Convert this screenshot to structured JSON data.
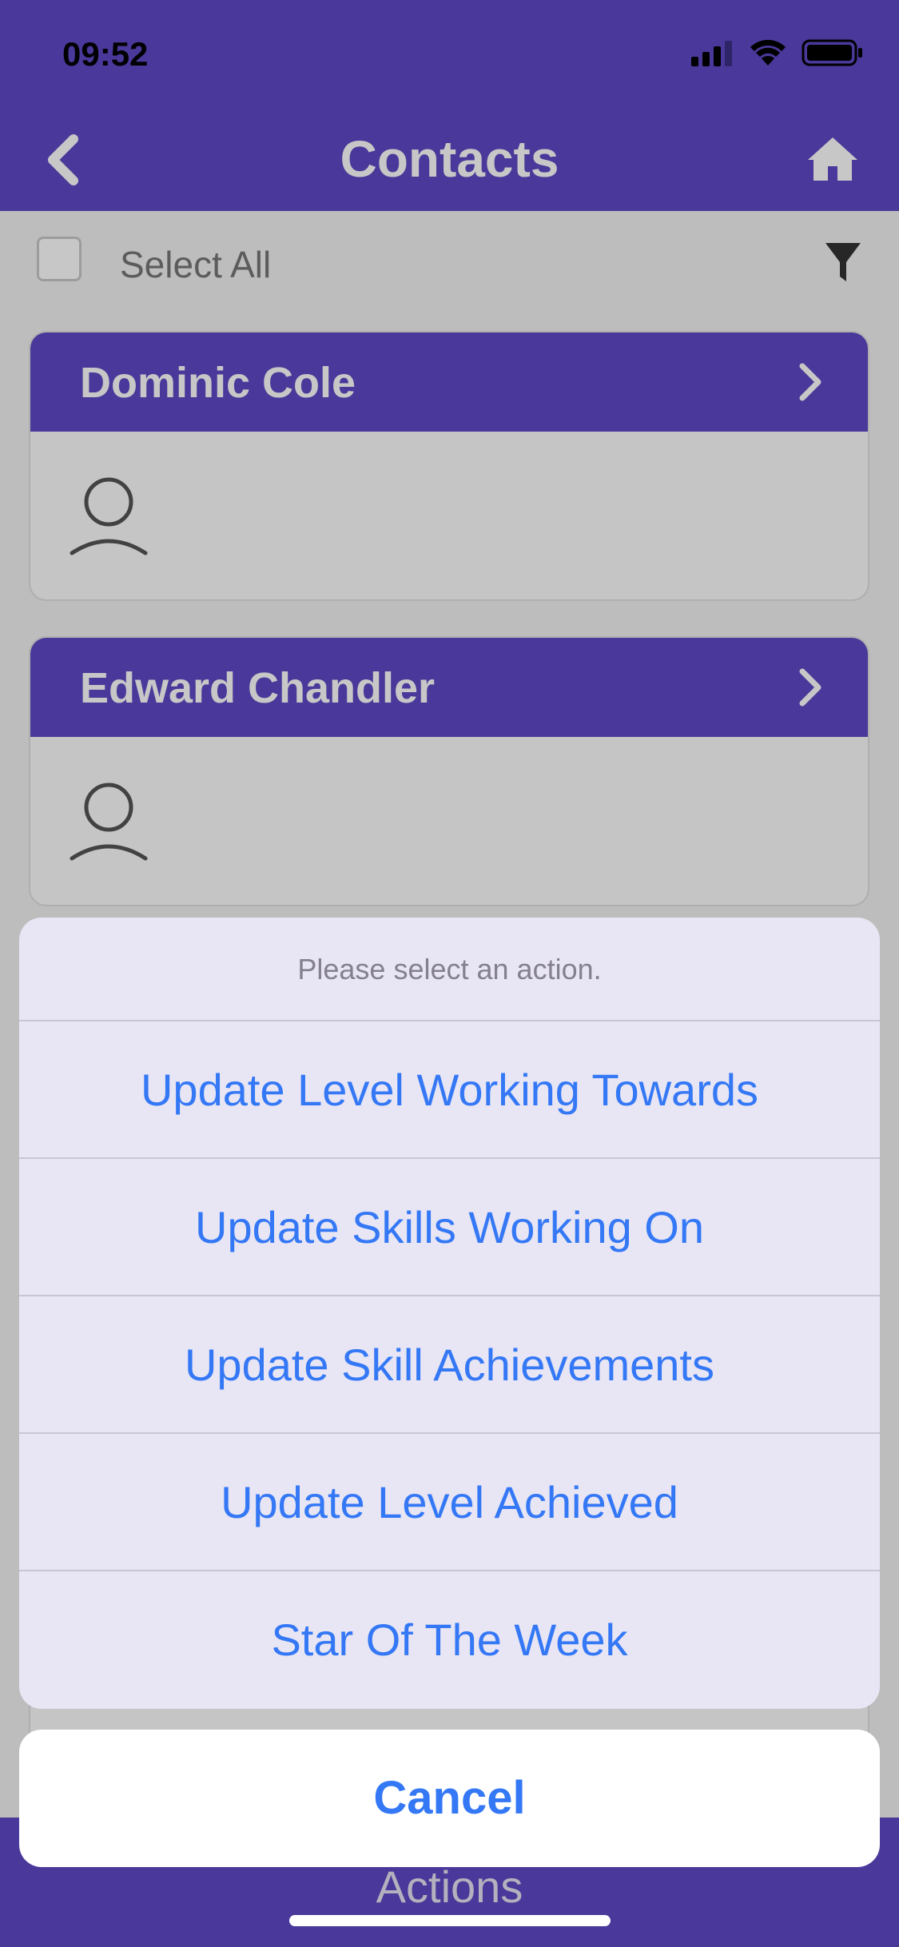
{
  "status_bar": {
    "time": "09:52"
  },
  "nav": {
    "title": "Contacts",
    "back_icon": "chevron-left-icon",
    "home_icon": "home-icon"
  },
  "list": {
    "select_all_label": "Select All",
    "filter_icon": "filter-icon",
    "contacts": [
      {
        "name": "Dominic Cole"
      },
      {
        "name": "Edward Chandler"
      }
    ]
  },
  "action_sheet": {
    "title": "Please select an action.",
    "actions": [
      "Update Level Working Towards",
      "Update Skills Working On",
      "Update Skill Achievements",
      "Update Level Achieved",
      "Star Of The Week"
    ],
    "cancel_label": "Cancel"
  },
  "bottom_bar": {
    "label": "Actions"
  },
  "colors": {
    "brand": "#5f48c6",
    "action_text": "#3478f6",
    "sheet_bg": "#e8e5f4"
  }
}
